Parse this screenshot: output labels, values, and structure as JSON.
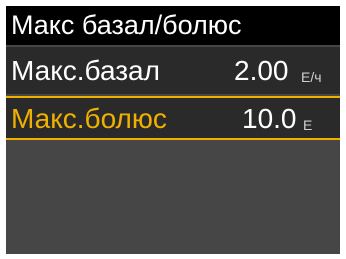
{
  "title": "Макс базал/болюс",
  "items": [
    {
      "label": "Макс.базал",
      "value": "2.00",
      "unit": "Е/ч"
    },
    {
      "label": "Макс.болюс",
      "value": "10.0",
      "unit": "Е"
    }
  ],
  "colors": {
    "background": "#464646",
    "title_bar": "#000000",
    "row": "#2a2a2a",
    "highlight": "#f0b000",
    "text": "#ffffff"
  }
}
